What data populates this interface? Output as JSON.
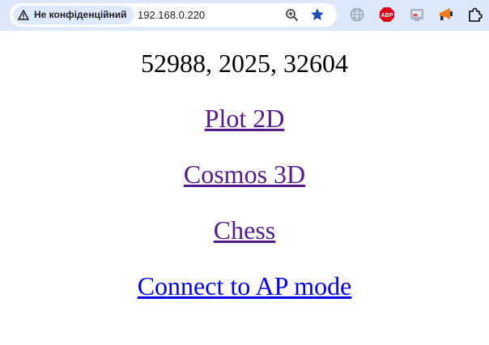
{
  "browser": {
    "security_label": "Не конфіденційний",
    "url": "192.168.0.220",
    "extensions": [
      "globe-extension-icon",
      "adblock-plus-icon",
      "screen-cast-icon",
      "announcement-icon",
      "puzzle-extensions-icon"
    ],
    "abp_badge": "ABP"
  },
  "page": {
    "numbers_line": "52988, 2025, 32604",
    "links": [
      {
        "label": "Plot 2D",
        "visited": true
      },
      {
        "label": "Cosmos 3D",
        "visited": true
      },
      {
        "label": "Chess",
        "visited": true
      },
      {
        "label": "Connect to AP mode",
        "visited": false
      }
    ]
  },
  "colors": {
    "toolbar_bg": "#dde9fb",
    "visited_link": "#551a8b",
    "unvisited_link": "#0000ee",
    "star": "#1a4fba"
  }
}
